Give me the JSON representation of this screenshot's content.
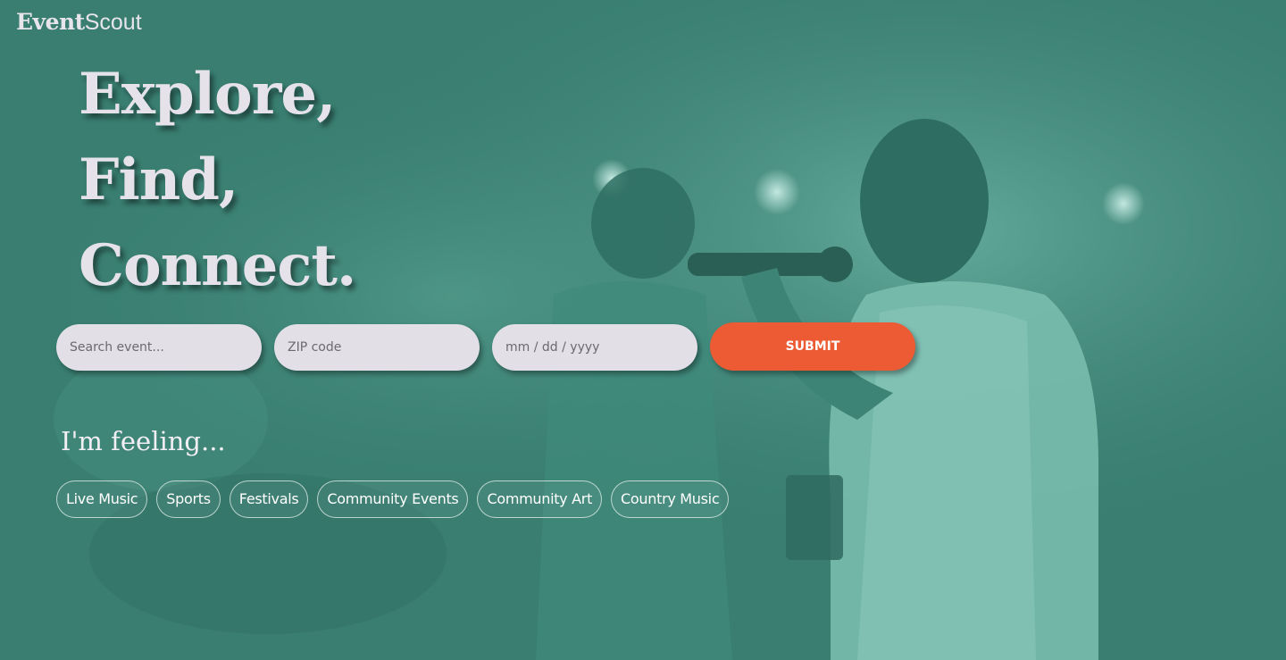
{
  "brand": {
    "name_bold": "Event",
    "name_light": "Scout"
  },
  "hero": {
    "lines": [
      "Explore,",
      "Find,",
      "Connect."
    ]
  },
  "search": {
    "event_placeholder": "Search event...",
    "zip_placeholder": "ZIP code",
    "date_placeholder": "mm / dd / yyyy",
    "submit_label": "SUBMIT"
  },
  "mood": {
    "heading": "I'm feeling...",
    "chips": [
      "Live Music",
      "Sports",
      "Festivals",
      "Community Events",
      "Community Art",
      "Country Music"
    ]
  },
  "colors": {
    "background_tint": "#3a7f72",
    "submit": "#ec5b33",
    "field": "#e2dfe6",
    "text_light": "#e5e2ea"
  }
}
